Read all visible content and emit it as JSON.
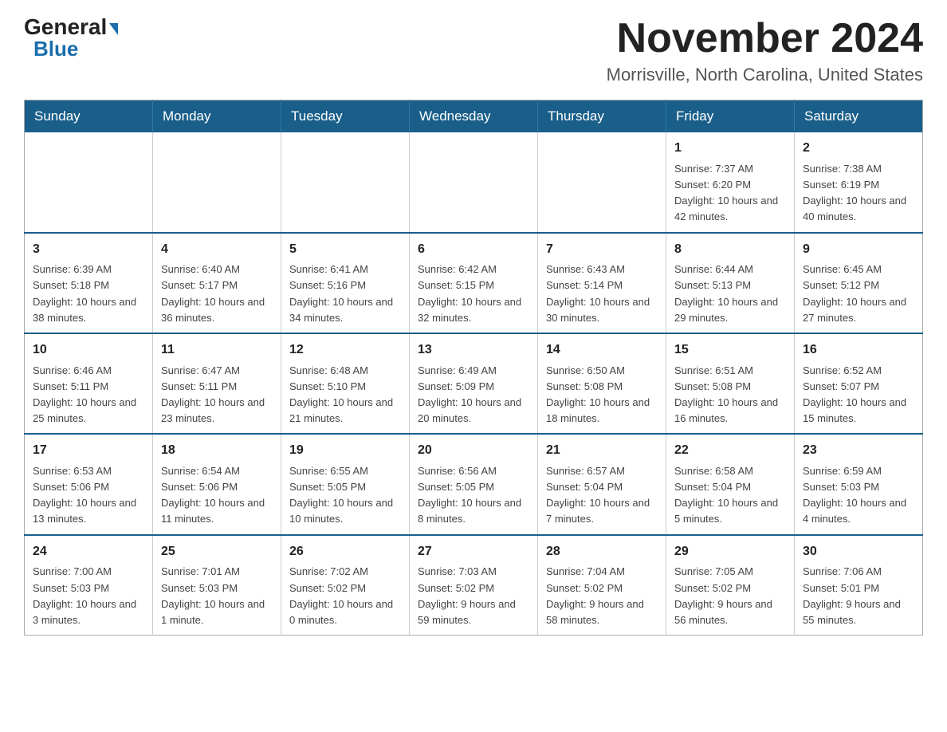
{
  "logo": {
    "general": "General",
    "blue": "Blue",
    "arrow": "▲"
  },
  "title": {
    "month_year": "November 2024",
    "location": "Morrisville, North Carolina, United States"
  },
  "days_of_week": [
    "Sunday",
    "Monday",
    "Tuesday",
    "Wednesday",
    "Thursday",
    "Friday",
    "Saturday"
  ],
  "weeks": [
    [
      {
        "day": "",
        "info": ""
      },
      {
        "day": "",
        "info": ""
      },
      {
        "day": "",
        "info": ""
      },
      {
        "day": "",
        "info": ""
      },
      {
        "day": "",
        "info": ""
      },
      {
        "day": "1",
        "info": "Sunrise: 7:37 AM\nSunset: 6:20 PM\nDaylight: 10 hours and 42 minutes."
      },
      {
        "day": "2",
        "info": "Sunrise: 7:38 AM\nSunset: 6:19 PM\nDaylight: 10 hours and 40 minutes."
      }
    ],
    [
      {
        "day": "3",
        "info": "Sunrise: 6:39 AM\nSunset: 5:18 PM\nDaylight: 10 hours and 38 minutes."
      },
      {
        "day": "4",
        "info": "Sunrise: 6:40 AM\nSunset: 5:17 PM\nDaylight: 10 hours and 36 minutes."
      },
      {
        "day": "5",
        "info": "Sunrise: 6:41 AM\nSunset: 5:16 PM\nDaylight: 10 hours and 34 minutes."
      },
      {
        "day": "6",
        "info": "Sunrise: 6:42 AM\nSunset: 5:15 PM\nDaylight: 10 hours and 32 minutes."
      },
      {
        "day": "7",
        "info": "Sunrise: 6:43 AM\nSunset: 5:14 PM\nDaylight: 10 hours and 30 minutes."
      },
      {
        "day": "8",
        "info": "Sunrise: 6:44 AM\nSunset: 5:13 PM\nDaylight: 10 hours and 29 minutes."
      },
      {
        "day": "9",
        "info": "Sunrise: 6:45 AM\nSunset: 5:12 PM\nDaylight: 10 hours and 27 minutes."
      }
    ],
    [
      {
        "day": "10",
        "info": "Sunrise: 6:46 AM\nSunset: 5:11 PM\nDaylight: 10 hours and 25 minutes."
      },
      {
        "day": "11",
        "info": "Sunrise: 6:47 AM\nSunset: 5:11 PM\nDaylight: 10 hours and 23 minutes."
      },
      {
        "day": "12",
        "info": "Sunrise: 6:48 AM\nSunset: 5:10 PM\nDaylight: 10 hours and 21 minutes."
      },
      {
        "day": "13",
        "info": "Sunrise: 6:49 AM\nSunset: 5:09 PM\nDaylight: 10 hours and 20 minutes."
      },
      {
        "day": "14",
        "info": "Sunrise: 6:50 AM\nSunset: 5:08 PM\nDaylight: 10 hours and 18 minutes."
      },
      {
        "day": "15",
        "info": "Sunrise: 6:51 AM\nSunset: 5:08 PM\nDaylight: 10 hours and 16 minutes."
      },
      {
        "day": "16",
        "info": "Sunrise: 6:52 AM\nSunset: 5:07 PM\nDaylight: 10 hours and 15 minutes."
      }
    ],
    [
      {
        "day": "17",
        "info": "Sunrise: 6:53 AM\nSunset: 5:06 PM\nDaylight: 10 hours and 13 minutes."
      },
      {
        "day": "18",
        "info": "Sunrise: 6:54 AM\nSunset: 5:06 PM\nDaylight: 10 hours and 11 minutes."
      },
      {
        "day": "19",
        "info": "Sunrise: 6:55 AM\nSunset: 5:05 PM\nDaylight: 10 hours and 10 minutes."
      },
      {
        "day": "20",
        "info": "Sunrise: 6:56 AM\nSunset: 5:05 PM\nDaylight: 10 hours and 8 minutes."
      },
      {
        "day": "21",
        "info": "Sunrise: 6:57 AM\nSunset: 5:04 PM\nDaylight: 10 hours and 7 minutes."
      },
      {
        "day": "22",
        "info": "Sunrise: 6:58 AM\nSunset: 5:04 PM\nDaylight: 10 hours and 5 minutes."
      },
      {
        "day": "23",
        "info": "Sunrise: 6:59 AM\nSunset: 5:03 PM\nDaylight: 10 hours and 4 minutes."
      }
    ],
    [
      {
        "day": "24",
        "info": "Sunrise: 7:00 AM\nSunset: 5:03 PM\nDaylight: 10 hours and 3 minutes."
      },
      {
        "day": "25",
        "info": "Sunrise: 7:01 AM\nSunset: 5:03 PM\nDaylight: 10 hours and 1 minute."
      },
      {
        "day": "26",
        "info": "Sunrise: 7:02 AM\nSunset: 5:02 PM\nDaylight: 10 hours and 0 minutes."
      },
      {
        "day": "27",
        "info": "Sunrise: 7:03 AM\nSunset: 5:02 PM\nDaylight: 9 hours and 59 minutes."
      },
      {
        "day": "28",
        "info": "Sunrise: 7:04 AM\nSunset: 5:02 PM\nDaylight: 9 hours and 58 minutes."
      },
      {
        "day": "29",
        "info": "Sunrise: 7:05 AM\nSunset: 5:02 PM\nDaylight: 9 hours and 56 minutes."
      },
      {
        "day": "30",
        "info": "Sunrise: 7:06 AM\nSunset: 5:01 PM\nDaylight: 9 hours and 55 minutes."
      }
    ]
  ]
}
